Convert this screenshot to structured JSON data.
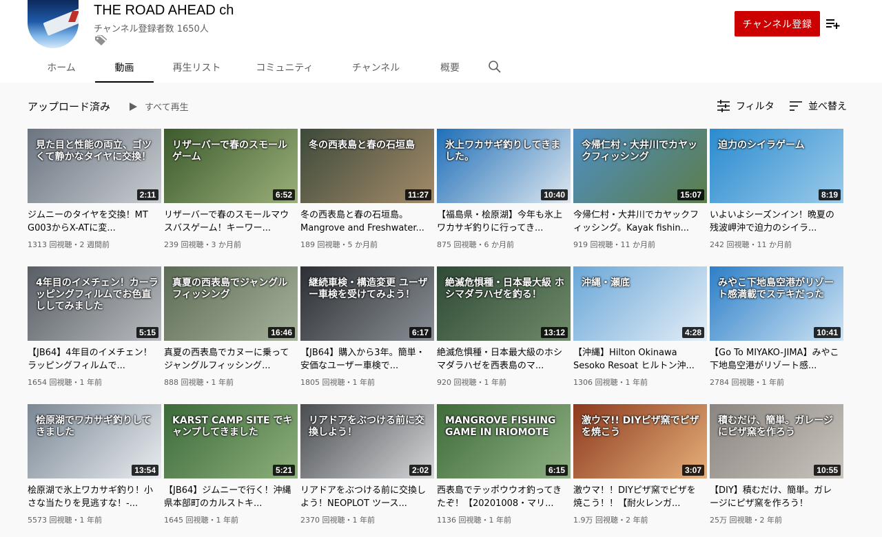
{
  "channel": {
    "name": "THE ROAD AHEAD ch",
    "subscribers": "チャンネル登録者数 1650人",
    "subscribe_label": "チャンネル登録"
  },
  "tabs": [
    {
      "label": "ホーム"
    },
    {
      "label": "動画"
    },
    {
      "label": "再生リスト"
    },
    {
      "label": "コミュニティ"
    },
    {
      "label": "チャンネル"
    },
    {
      "label": "概要"
    }
  ],
  "toolbar": {
    "section_title": "アップロード済み",
    "play_all": "すべて再生",
    "filter": "フィルタ",
    "sort": "並べ替え"
  },
  "videos": [
    {
      "title": "ジムニーのタイヤを交換！MT G003からX-ATに変...",
      "meta": "1313 回視聴・2 週間前",
      "duration": "2:11",
      "thumb_text": "見た目と性能の両立、ゴツくて静かなタイヤに交換！",
      "colors": [
        "#6b7480",
        "#c9cdd2"
      ]
    },
    {
      "title": "リザーバーで春のスモールマウスバスゲーム！キーワー...",
      "meta": "239 回視聴・3 か月前",
      "duration": "6:52",
      "thumb_text": "リザーバーで春のスモールゲーム",
      "colors": [
        "#3c5a2c",
        "#9bb07a"
      ]
    },
    {
      "title": "冬の西表島と春の石垣島。Mangrove and Freshwater...",
      "meta": "189 回視聴・5 か月前",
      "duration": "11:27",
      "thumb_text": "冬の西表島と春の石垣島",
      "colors": [
        "#3d4a3a",
        "#a58b6a"
      ]
    },
    {
      "title": "【福島県・桧原湖】今年も氷上ワカサギ釣りに行ってき...",
      "meta": "875 回視聴・6 か月前",
      "duration": "10:40",
      "thumb_text": "氷上ワカサギ釣りしてきました。",
      "colors": [
        "#1e6fb8",
        "#dfe7ef"
      ]
    },
    {
      "title": "今帰仁村・大井川でカヤックフィッシング。Kayak fishin...",
      "meta": "919 回視聴・11 か月前",
      "duration": "15:07",
      "thumb_text": "今帰仁村・大井川でカヤックフィッシング",
      "colors": [
        "#4d8fc4",
        "#5d7d4a"
      ]
    },
    {
      "title": "いよいよシーズンイン！晩夏の残波岬沖で迫力のシイラ...",
      "meta": "242 回視聴・11 か月前",
      "duration": "8:19",
      "thumb_text": "迫力のシイラゲーム",
      "colors": [
        "#2a8bd0",
        "#9ccbe9"
      ]
    },
    {
      "title": "【JB64】4年目のイメチェン！ラッピングフィルムで...",
      "meta": "1654 回視聴・1 年前",
      "duration": "5:15",
      "thumb_text": "4年目のイメチェン！カーラッピングフィルムでお色直ししてみました",
      "colors": [
        "#585e64",
        "#b8bcc0"
      ]
    },
    {
      "title": "真夏の西表島でカヌーに乗ってジャングルフィッシング...",
      "meta": "888 回視聴・1 年前",
      "duration": "16:46",
      "thumb_text": "真夏の西表島でジャングルフィッシング",
      "colors": [
        "#5c6b55",
        "#a7b39c"
      ]
    },
    {
      "title": "【JB64】購入から3年。簡単・安価なユーザー車検で...",
      "meta": "1805 回視聴・1 年前",
      "duration": "6:17",
      "thumb_text": "継続車検・構造変更 ユーザー車検を受けてみよう！",
      "colors": [
        "#2c2f33",
        "#8a9096"
      ]
    },
    {
      "title": "絶滅危惧種・日本最大級のホシマダラハゼを西表島のマ...",
      "meta": "920 回視聴・1 年前",
      "duration": "13:12",
      "thumb_text": "絶滅危惧種・日本最大級 ホシマダラハゼを釣る！",
      "colors": [
        "#2f4a36",
        "#6f8b6a"
      ]
    },
    {
      "title": "【沖縄】Hilton Okinawa Sesoko Resoat ヒルトン沖...",
      "meta": "1306 回視聴・1 年前",
      "duration": "4:28",
      "thumb_text": "沖縄・瀬底",
      "colors": [
        "#6aa7d8",
        "#e4eef6"
      ]
    },
    {
      "title": "【Go To MIYAKO-JIMA】みやこ下地島空港がリゾート感...",
      "meta": "2784 回視聴・1 年前",
      "duration": "10:41",
      "thumb_text": "みやこ下地島空港がリゾート感満載でステキだった",
      "colors": [
        "#2d7fc8",
        "#cfe4f4"
      ]
    },
    {
      "title": "桧原湖で氷上ワカサギ釣り！小さな当たりを見逃すな！-...",
      "meta": "5573 回視聴・1 年前",
      "duration": "13:54",
      "thumb_text": "桧原湖でワカサギ釣りしてきました",
      "colors": [
        "#7a8794",
        "#e9edf0"
      ]
    },
    {
      "title": "【JB64】ジムニーで行く！沖縄県本部町のカルストキ...",
      "meta": "1645 回視聴・1 年前",
      "duration": "5:21",
      "thumb_text": "KARST CAMP SITE でキャンプしてきました",
      "colors": [
        "#3c6a3a",
        "#8eb07c"
      ]
    },
    {
      "title": "リアドアをぶつける前に交換しよう！NEOPLOT ツース...",
      "meta": "2370 回視聴・1 年前",
      "duration": "2:02",
      "thumb_text": "リアドアをぶつける前に交換しよう！",
      "colors": [
        "#4a4d50",
        "#d5d7d9"
      ]
    },
    {
      "title": "西表島でテッポウウオ釣ってきたぞ！【20201008・マリ...",
      "meta": "1136 回視聴・1 年前",
      "duration": "6:15",
      "thumb_text": "MANGROVE FISHING GAME IN IRIOMOTE",
      "colors": [
        "#3f6b3a",
        "#8fb184"
      ]
    },
    {
      "title": "激ウマ！！DIYピザ窯でピザを焼こう！！【耐火レンガ...",
      "meta": "1.9万 回視聴・2 年前",
      "duration": "3:07",
      "thumb_text": "激ウマ!! DIYピザ窯でピザを焼こう",
      "colors": [
        "#8c3a1e",
        "#e6b07a"
      ]
    },
    {
      "title": "【DIY】積むだけ、簡単。ガレージにピザ窯を作ろう！",
      "meta": "25万 回視聴・2 年前",
      "duration": "10:55",
      "thumb_text": "積むだけ、簡単。ガレージにピザ窯を作ろう",
      "colors": [
        "#8a8580",
        "#c9c4bd"
      ]
    }
  ]
}
